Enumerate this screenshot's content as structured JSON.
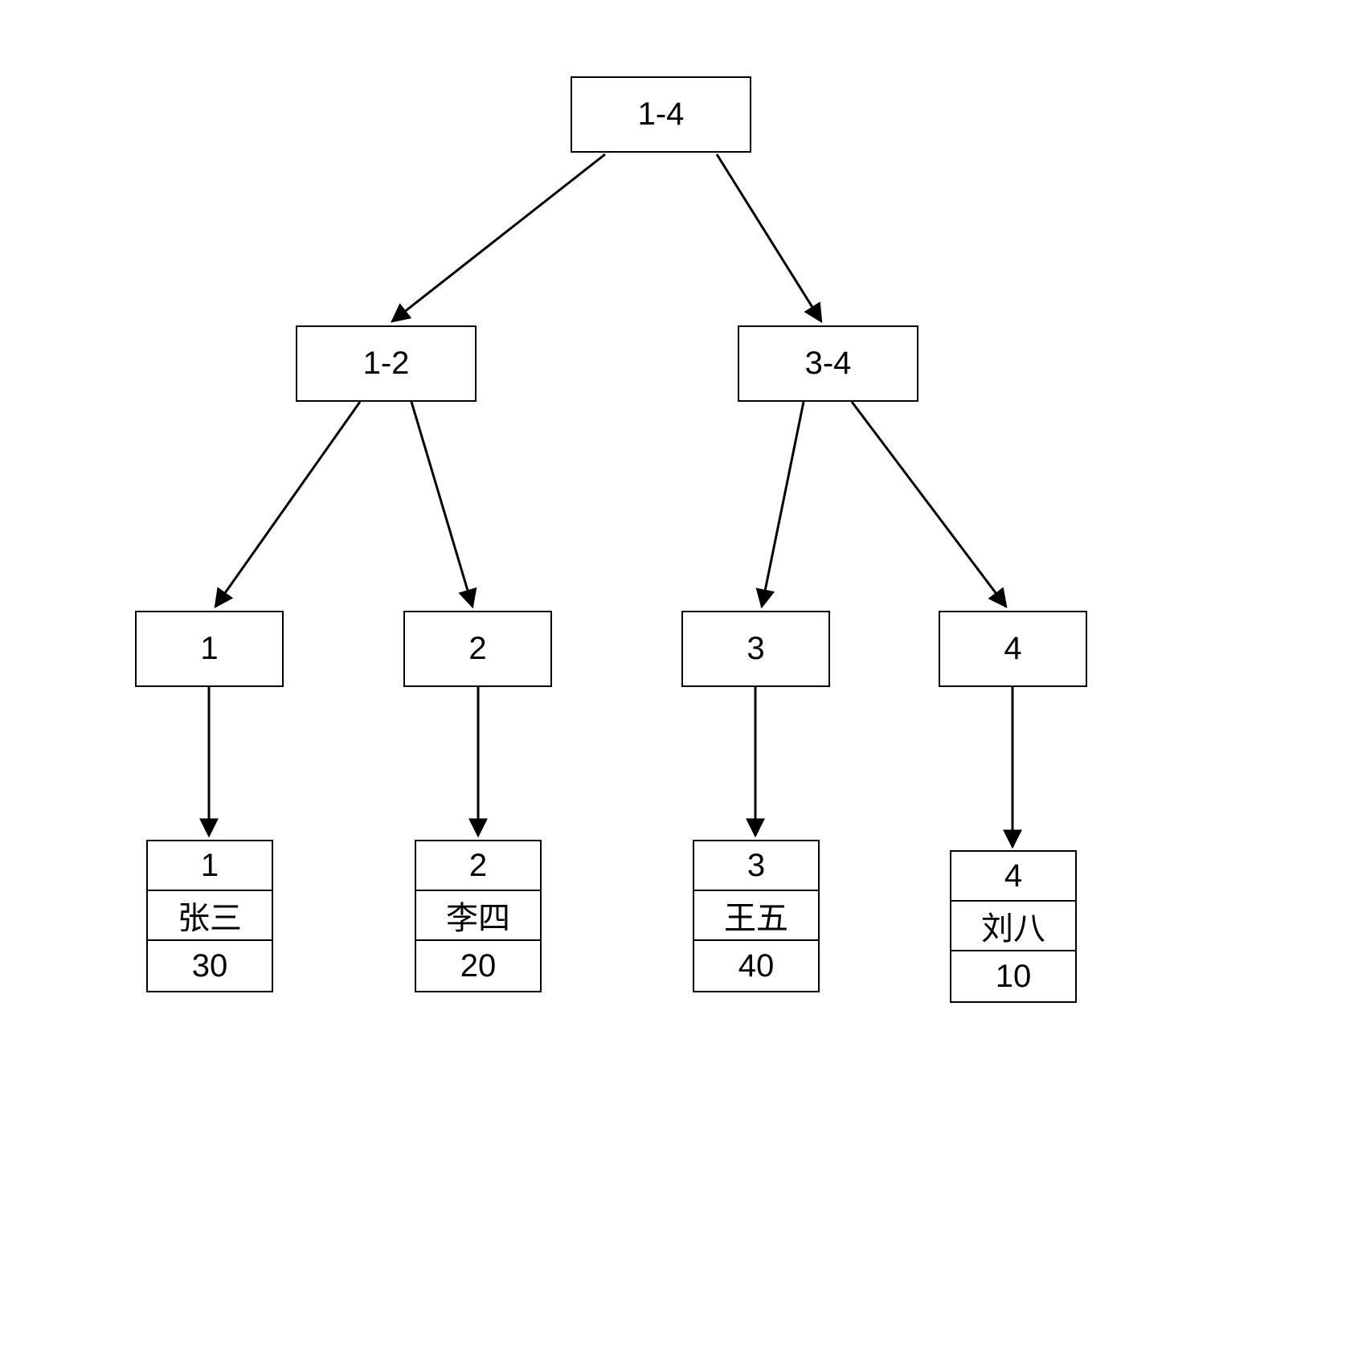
{
  "tree": {
    "root": {
      "label": "1-4"
    },
    "left": {
      "label": "1-2"
    },
    "right": {
      "label": "3-4"
    },
    "leaf1": {
      "label": "1"
    },
    "leaf2": {
      "label": "2"
    },
    "leaf3": {
      "label": "3"
    },
    "leaf4": {
      "label": "4"
    },
    "records": [
      {
        "id": "1",
        "name": "张三",
        "value": "30"
      },
      {
        "id": "2",
        "name": "李四",
        "value": "20"
      },
      {
        "id": "3",
        "name": "王五",
        "value": "40"
      },
      {
        "id": "4",
        "name": "刘八",
        "value": "10"
      }
    ]
  }
}
